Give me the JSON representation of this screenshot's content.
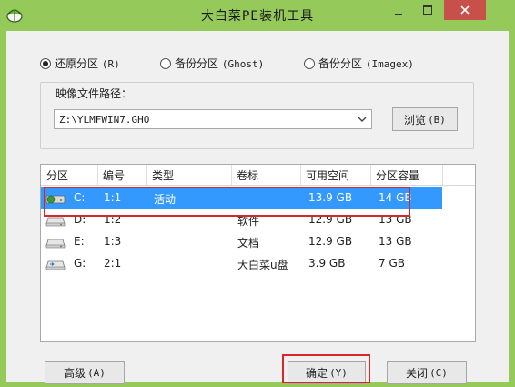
{
  "window": {
    "title": "大白菜PE装机工具",
    "icon": "cabbage-icon",
    "colors": {
      "frame": "#95c95a",
      "close": "#c7504a",
      "selection": "#3399ff",
      "highlight": "#d8262b"
    }
  },
  "modes": [
    {
      "label": "还原分区",
      "hotkey": "(R)",
      "checked": true
    },
    {
      "label": "备份分区",
      "hotkey": "(Ghost)",
      "checked": false
    },
    {
      "label": "备份分区",
      "hotkey": "(Imagex)",
      "checked": false
    }
  ],
  "image_path": {
    "label": "映像文件路径：",
    "value": "Z:\\YLMFWIN7.GHO",
    "browse_label": "浏览",
    "browse_hotkey": "(B)"
  },
  "partitions": {
    "columns": [
      "分区",
      "编号",
      "类型",
      "卷标",
      "可用空间",
      "分区容量"
    ],
    "rows": [
      {
        "drive": "C:",
        "num": "1:1",
        "type": "活动",
        "label": "",
        "free": "13.9 GB",
        "size": "14 GB",
        "selected": true,
        "icon": "drive-system-icon"
      },
      {
        "drive": "D:",
        "num": "1:2",
        "type": "",
        "label": "软件",
        "free": "12.9 GB",
        "size": "13 GB",
        "selected": false,
        "icon": "drive-icon"
      },
      {
        "drive": "E:",
        "num": "1:3",
        "type": "",
        "label": "文档",
        "free": "12.9 GB",
        "size": "13 GB",
        "selected": false,
        "icon": "drive-icon"
      },
      {
        "drive": "G:",
        "num": "2:1",
        "type": "",
        "label": "大白菜u盘",
        "free": "3.9 GB",
        "size": "7 GB",
        "selected": false,
        "icon": "usb-drive-icon"
      }
    ]
  },
  "buttons": {
    "advanced_label": "高级",
    "advanced_hotkey": "(A)",
    "ok_label": "确定",
    "ok_hotkey": "(Y)",
    "close_label": "关闭",
    "close_hotkey": "(C)"
  }
}
